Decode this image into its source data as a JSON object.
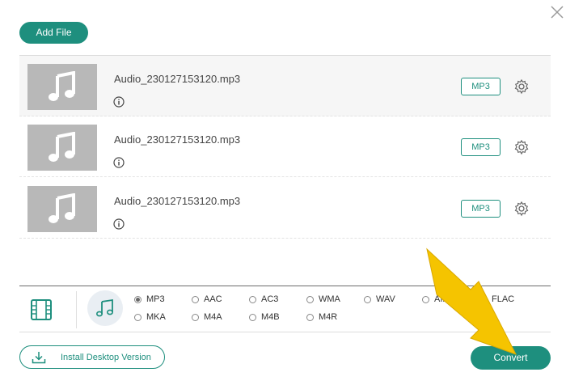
{
  "window": {
    "close_icon": "close-icon"
  },
  "toolbar": {
    "add_file_label": "Add File"
  },
  "files": [
    {
      "name": "Audio_230127153120.mp3",
      "format": "MP3",
      "thumb_icon": "music-note-icon"
    },
    {
      "name": "Audio_230127153120.mp3",
      "format": "MP3",
      "thumb_icon": "music-note-icon"
    },
    {
      "name": "Audio_230127153120.mp3",
      "format": "MP3",
      "thumb_icon": "music-note-icon"
    }
  ],
  "format_bar": {
    "tabs": [
      "video-film-icon",
      "music-note-icon"
    ],
    "options_row1": [
      "MP3",
      "AAC",
      "AC3",
      "WMA",
      "WAV",
      "AIFF",
      "FLAC"
    ],
    "options_row2": [
      "MKA",
      "M4A",
      "M4B",
      "M4R"
    ],
    "selected": "MP3"
  },
  "footer": {
    "install_label": "Install Desktop Version",
    "convert_label": "Convert"
  },
  "colors": {
    "accent": "#1e8f7e",
    "arrow": "#f5c400"
  }
}
